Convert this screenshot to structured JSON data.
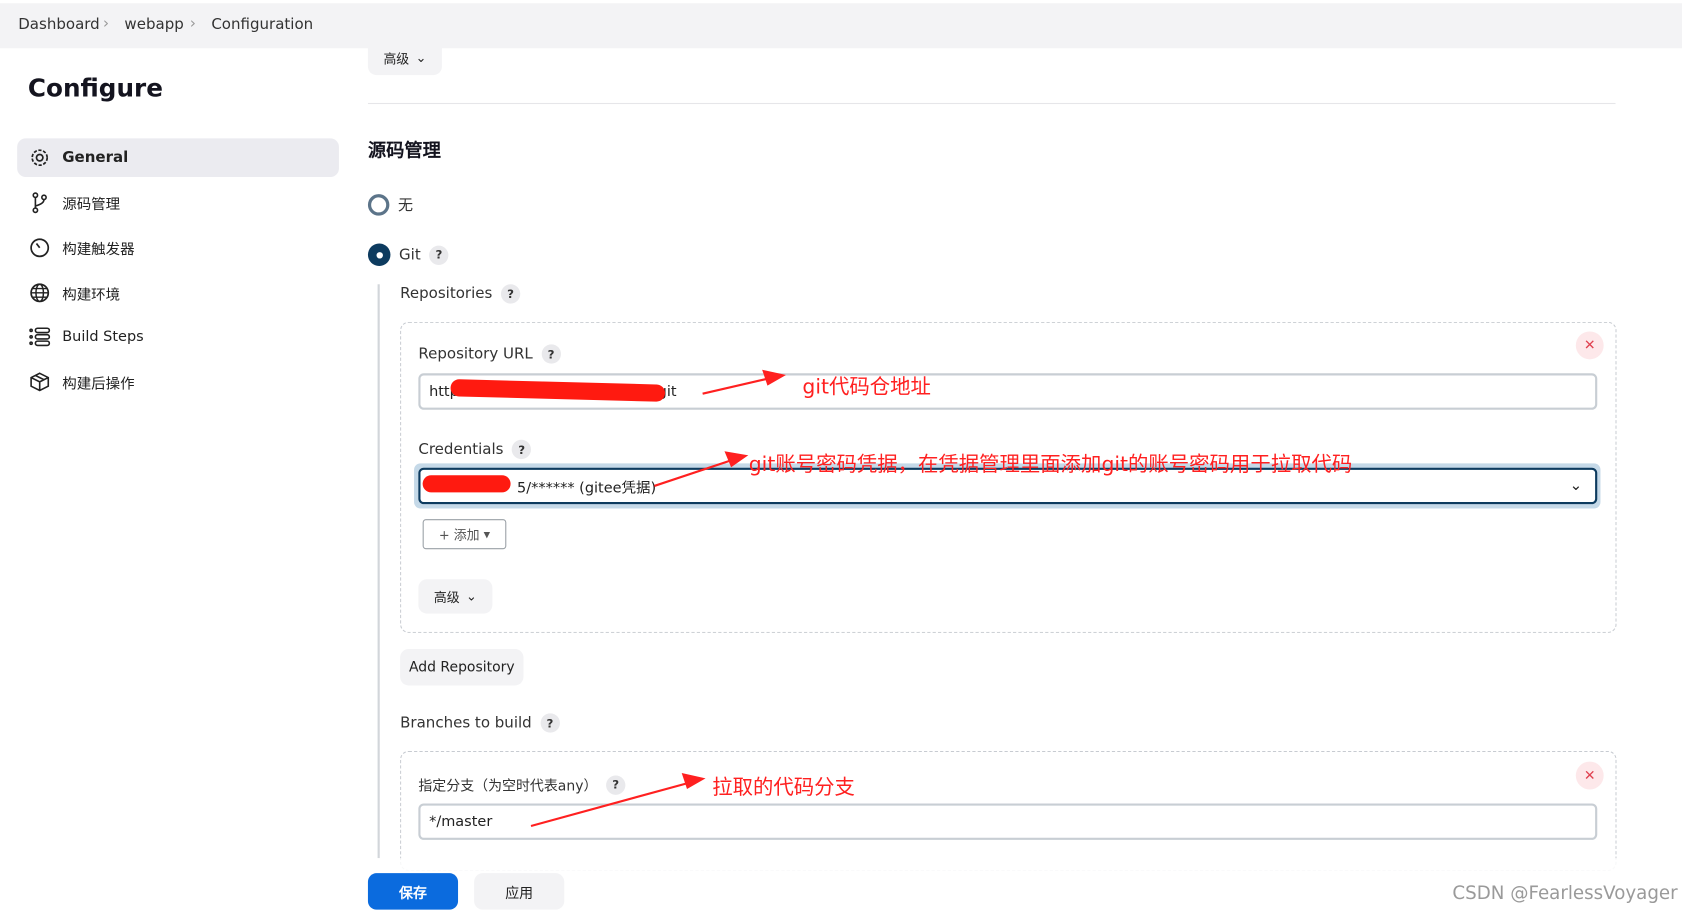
{
  "breadcrumb": [
    "Dashboard",
    "webapp",
    "Configuration"
  ],
  "sidebar": {
    "title": "Configure",
    "items": [
      {
        "label": "General",
        "icon": "gear-icon",
        "active": true
      },
      {
        "label": "源码管理",
        "icon": "branch-icon"
      },
      {
        "label": "构建触发器",
        "icon": "timer-icon"
      },
      {
        "label": "构建环境",
        "icon": "globe-icon"
      },
      {
        "label": "Build Steps",
        "icon": "list-icon"
      },
      {
        "label": "构建后操作",
        "icon": "package-icon"
      }
    ]
  },
  "main": {
    "top_advanced": "高级",
    "section_title": "源码管理",
    "scm_options": [
      {
        "label": "无",
        "selected": false
      },
      {
        "label": "Git",
        "selected": true
      }
    ],
    "repositories_label": "Repositories",
    "repo_url_label": "Repository URL",
    "repo_url_value": "https://...y.git",
    "repo_url_visible_start": "http",
    "repo_url_visible_end": "y.git",
    "credentials_label": "Credentials",
    "credentials_visible": "5/****** (gitee凭据)",
    "add_label": "+ 添加",
    "advanced_label": "高级",
    "add_repository": "Add Repository",
    "branches_label": "Branches to build",
    "branch_spec_label": "指定分支（为空时代表any）",
    "branch_value": "*/master"
  },
  "footer": {
    "save": "保存",
    "apply": "应用"
  },
  "annotations": {
    "url_note": "git代码仓地址",
    "cred_note": "git账号密码凭据，在凭据管理里面添加git的账号密码用于拉取代码",
    "branch_note": "拉取的代码分支",
    "accent": "#ff2020"
  },
  "watermark": "CSDN @FearlessVoyager",
  "colors": {
    "primary": "#0b6bde",
    "radio": "#0d3b5f"
  }
}
